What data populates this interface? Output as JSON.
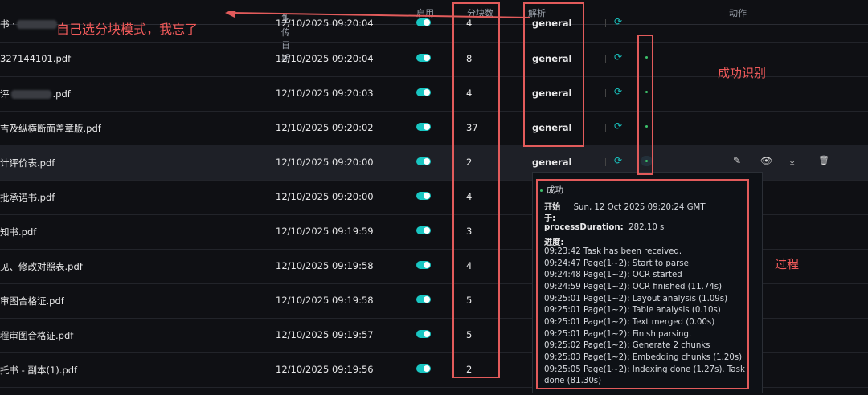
{
  "header": {
    "upload_date": "上传日期",
    "sort_icon": "⇅",
    "enabled": "启用",
    "chunks": "分块数",
    "parser": "解析",
    "actions": "动作"
  },
  "rows": [
    {
      "name": "书 ·",
      "date": "12/10/2025 09:20:04",
      "chunks": "4",
      "parser": "general"
    },
    {
      "name": "327144101.pdf",
      "date": "12/10/2025 09:20:04",
      "chunks": "8",
      "parser": "general"
    },
    {
      "name": "评",
      "name_suffix": ".pdf",
      "date": "12/10/2025 09:20:03",
      "chunks": "4",
      "parser": "general"
    },
    {
      "name": "吉及纵横断面盖章版.pdf",
      "date": "12/10/2025 09:20:02",
      "chunks": "37",
      "parser": "general"
    },
    {
      "name": "计评价表.pdf",
      "date": "12/10/2025 09:20:00",
      "chunks": "2",
      "parser": "general"
    },
    {
      "name": "批承诺书.pdf",
      "date": "12/10/2025 09:20:00",
      "chunks": "4",
      "parser": ""
    },
    {
      "name": "知书.pdf",
      "date": "12/10/2025 09:19:59",
      "chunks": "3",
      "parser": ""
    },
    {
      "name": "见、修改对照表.pdf",
      "date": "12/10/2025 09:19:58",
      "chunks": "4",
      "parser": ""
    },
    {
      "name": "审图合格证.pdf",
      "date": "12/10/2025 09:19:58",
      "chunks": "5",
      "parser": ""
    },
    {
      "name": "程审图合格证.pdf",
      "date": "12/10/2025 09:19:57",
      "chunks": "5",
      "parser": ""
    },
    {
      "name": "托书 - 副本(1).pdf",
      "date": "12/10/2025 09:19:56",
      "chunks": "2",
      "parser": ""
    }
  ],
  "icons": {
    "reload": "⟳",
    "edit": "✎",
    "view": "👁",
    "download": "⤓",
    "delete": "🗑"
  },
  "annotations": {
    "top": "自己选分块模式，我忘了",
    "success": "成功识别",
    "process": "过程"
  },
  "tooltip": {
    "status": "成功",
    "start_label": "开始",
    "start_label2": "于:",
    "start_value": "Sun, 12 Oct 2025 09:20:24 GMT",
    "duration_label": "processDuration:",
    "duration_value": "282.10 s",
    "progress_label": "进度:",
    "log": [
      "09:23:42 Task has been received.",
      "09:24:47 Page(1~2): Start to parse.",
      "09:24:48 Page(1~2): OCR started",
      "09:24:59 Page(1~2): OCR finished (11.74s)",
      "09:25:01 Page(1~2): Layout analysis (1.09s)",
      "09:25:01 Page(1~2): Table analysis (0.10s)",
      "09:25:01 Page(1~2): Text merged (0.00s)",
      "09:25:01 Page(1~2): Finish parsing.",
      "09:25:02 Page(1~2): Generate 2 chunks",
      "09:25:03 Page(1~2): Embedding chunks (1.20s)",
      "09:25:05 Page(1~2): Indexing done (1.27s). Task",
      "done (81.30s)"
    ]
  },
  "colors": {
    "accent": "#19c6c2",
    "success": "#3cc16a",
    "annotation": "#e25b5b"
  }
}
